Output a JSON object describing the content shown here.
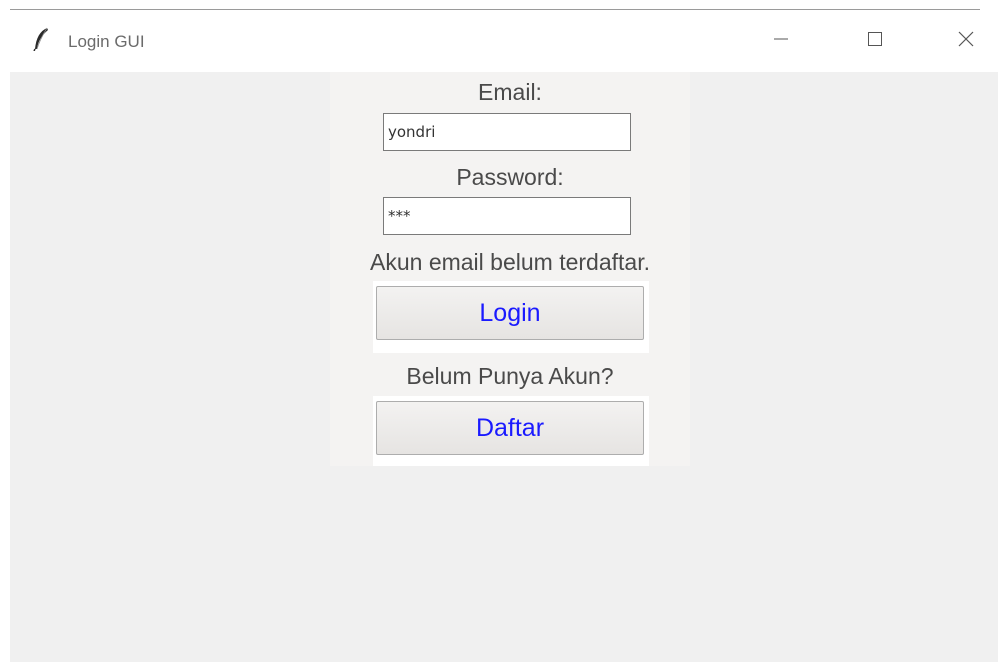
{
  "window": {
    "title": "Login GUI",
    "app_icon": "feather-icon",
    "controls": {
      "minimize_icon": "minimize-icon",
      "maximize_icon": "maximize-icon",
      "close_icon": "close-icon"
    }
  },
  "form": {
    "email_label": "Email:",
    "email_value": "yondri",
    "password_label": "Password:",
    "password_value": "***",
    "status_message": "Akun email belum terdaftar.",
    "login_button": "Login",
    "register_prompt": "Belum Punya Akun?",
    "register_button": "Daftar"
  },
  "colors": {
    "button_text": "#1a1aff",
    "background": "#f0f0f0",
    "panel": "#f4f3f2"
  }
}
